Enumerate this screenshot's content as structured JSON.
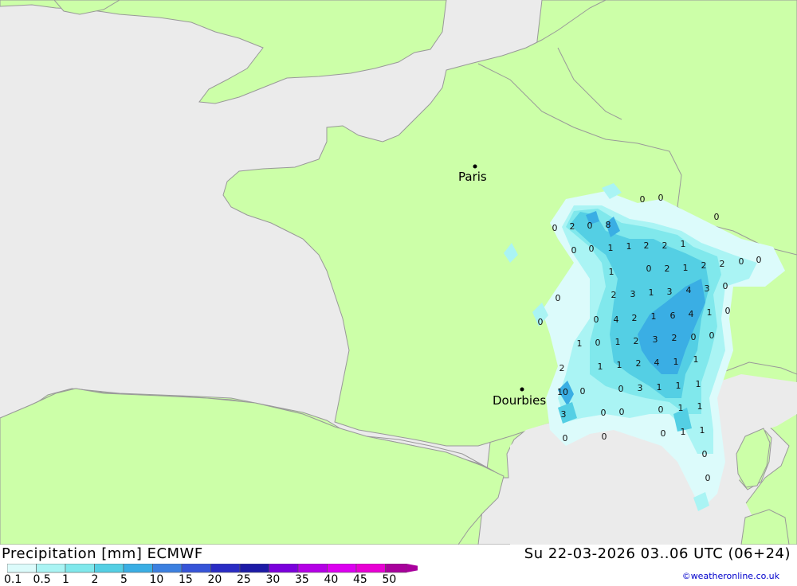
{
  "title": "Precipitation [mm] ECMWF",
  "datetime": "Su 22-03-2026 03..06 UTC (06+24)",
  "credit": "©weatheronline.co.uk",
  "cities": [
    {
      "name": "Paris"
    },
    {
      "name": "Dourbies"
    }
  ],
  "legend": {
    "ticks": [
      "0.1",
      "0.5",
      "1",
      "2",
      "5",
      "10",
      "15",
      "20",
      "25",
      "30",
      "35",
      "40",
      "45",
      "50"
    ],
    "colors": [
      "#dcfbfb",
      "#aaf4f4",
      "#80e8ec",
      "#54cfe4",
      "#3aaee4",
      "#3c80e0",
      "#3654d8",
      "#2a2cc4",
      "#1c1aa6",
      "#7a00dc",
      "#b400e6",
      "#dc00f0",
      "#e800d4",
      "#a8009c"
    ]
  },
  "colors": {
    "sea": "#ebebeb",
    "land": "#ccffa8",
    "border": "#999999"
  },
  "values": [
    "0",
    "2",
    "0",
    "8",
    "0",
    "0",
    "0",
    "0",
    "1",
    "1",
    "2",
    "2",
    "1",
    "1",
    "0",
    "2",
    "1",
    "2",
    "2",
    "0",
    "0",
    "0",
    "2",
    "3",
    "1",
    "3",
    "4",
    "3",
    "0",
    "0",
    "0",
    "4",
    "2",
    "1",
    "6",
    "4",
    "1",
    "0",
    "0",
    "1",
    "0",
    "1",
    "2",
    "3",
    "2",
    "0",
    "0",
    "2",
    "1",
    "1",
    "2",
    "4",
    "1",
    "10",
    "0",
    "1",
    "0",
    "3",
    "1",
    "1",
    "1",
    "3",
    "0",
    "0",
    "0",
    "1",
    "1",
    "0",
    "0",
    "1",
    "1",
    "0",
    "0",
    "0"
  ]
}
